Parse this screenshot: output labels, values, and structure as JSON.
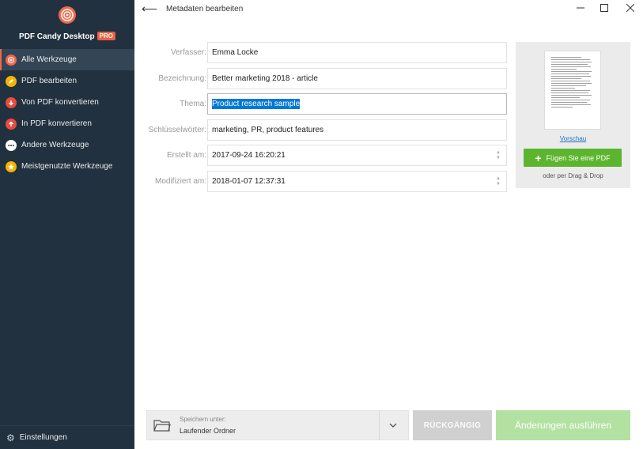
{
  "app": {
    "name": "PDF Candy Desktop",
    "badge": "PRO"
  },
  "sidebar": {
    "items": [
      {
        "label": "Alle Werkzeuge",
        "icon": "candy-swirl-icon",
        "color": "#f2674a",
        "active": true
      },
      {
        "label": "PDF bearbeiten",
        "icon": "pencil-icon",
        "color": "#f5b400",
        "active": false
      },
      {
        "label": "Von PDF konvertieren",
        "icon": "arrow-down-icon",
        "color": "#e84c3d",
        "active": false
      },
      {
        "label": "In PDF konvertieren",
        "icon": "arrow-up-icon",
        "color": "#e84c3d",
        "active": false
      },
      {
        "label": "Andere Werkzeuge",
        "icon": "more-dots-icon",
        "color": "#ffffff",
        "active": false
      },
      {
        "label": "Meistgenutzte Werkzeuge",
        "icon": "star-icon",
        "color": "#f5b400",
        "active": false
      }
    ],
    "settings_label": "Einstellungen"
  },
  "header": {
    "title": "Metadaten bearbeiten"
  },
  "form": {
    "author": {
      "label": "Verfasser:",
      "value": "Emma Locke"
    },
    "title": {
      "label": "Bezeichnung:",
      "value": "Better marketing 2018 - article"
    },
    "subject": {
      "label": "Thema:",
      "value": "Product research sample"
    },
    "keywords": {
      "label": "Schlüsselwörter:",
      "value": "marketing, PR, product features"
    },
    "created": {
      "label": "Erstellt am:",
      "value": "2017-09-24 16:20:21"
    },
    "modified": {
      "label": "Modifiziert am:",
      "value": "2018-01-07 12:37:31"
    }
  },
  "preview": {
    "link": "Vorschau",
    "add_button": "Fügen Sie eine PDF",
    "drag_hint": "oder per Drag & Drop"
  },
  "footer": {
    "save_label": "Speichern unter:",
    "save_value": "Laufender Ordner",
    "undo": "RÜCKGÄNGIG",
    "apply": "Änderungen ausführen"
  },
  "colors": {
    "sidebar_bg": "#22313f",
    "accent": "#f2674a",
    "add_button": "#5cb52f",
    "apply_disabled": "#b3e1a2",
    "selection": "#0078d7"
  }
}
